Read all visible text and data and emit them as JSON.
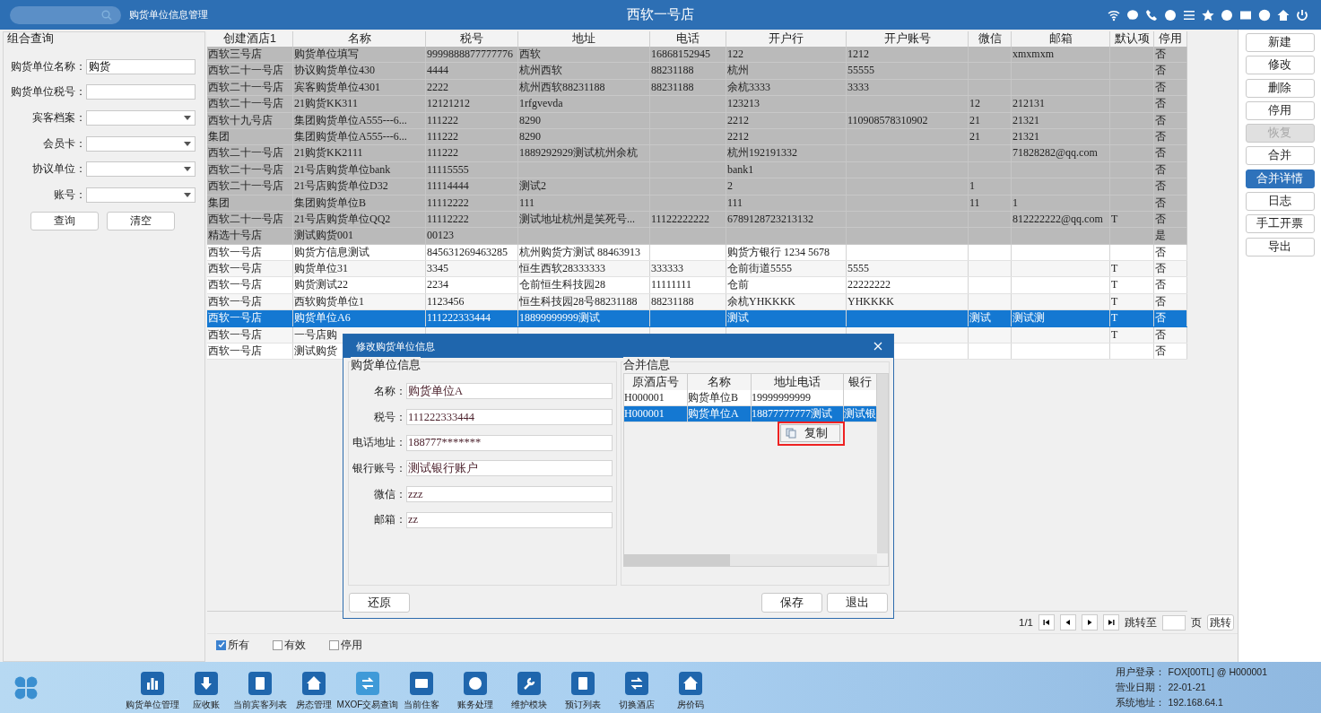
{
  "top_bar": {
    "module_title": "购货单位信息管理",
    "hotel": "西软一号店"
  },
  "filter": {
    "title": "组合查询",
    "fields": [
      {
        "label": "购货单位名称：",
        "kind": "text",
        "value": "购货"
      },
      {
        "label": "购货单位税号：",
        "kind": "text"
      },
      {
        "label": "宾客档案：",
        "kind": "select"
      },
      {
        "label": "会员卡：",
        "kind": "select"
      },
      {
        "label": "协议单位：",
        "kind": "select"
      },
      {
        "label": "账号：",
        "kind": "select"
      }
    ],
    "buttons": [
      "查询",
      "清空"
    ]
  },
  "table": {
    "columns": [
      "创建酒店1",
      "名称",
      "税号",
      "地址",
      "电话",
      "开户行",
      "开户账号",
      "微信",
      "邮箱",
      "默认项",
      "停用"
    ],
    "rows": [
      {
        "shaded": true,
        "selected": false,
        "cells": [
          "西软三号店",
          "购货单位填写",
          "9999888877777776",
          "西软",
          "16868152945",
          "122",
          "1212",
          null,
          "xmxmxm",
          null,
          "否"
        ]
      },
      {
        "shaded": true,
        "selected": false,
        "cells": [
          "西软二十一号店",
          "协议购货单位430",
          "4444",
          "杭州西软",
          "88231188",
          "杭州",
          "55555",
          null,
          null,
          null,
          "否"
        ]
      },
      {
        "shaded": true,
        "selected": false,
        "cells": [
          "西软二十一号店",
          "宾客购货单位4301",
          "2222",
          "杭州西软88231188",
          "88231188",
          "余杭3333",
          "3333",
          null,
          null,
          null,
          "否"
        ]
      },
      {
        "shaded": true,
        "selected": false,
        "cells": [
          "西软二十一号店",
          "21购货KK311",
          "12121212",
          "1rfgvevda",
          null,
          "123213",
          null,
          "12",
          "212131",
          null,
          "否"
        ]
      },
      {
        "shaded": true,
        "selected": false,
        "cells": [
          "西软十九号店",
          "集团购货单位A555---6...",
          "111222",
          "8290",
          null,
          "2212",
          "110908578310902",
          "21",
          "21321",
          null,
          "否"
        ]
      },
      {
        "shaded": true,
        "selected": false,
        "cells": [
          "集团",
          "集团购货单位A555---6...",
          "111222",
          "8290",
          null,
          "2212",
          null,
          "21",
          "21321",
          null,
          "否"
        ]
      },
      {
        "shaded": true,
        "selected": false,
        "cells": [
          "西软二十一号店",
          "21购货KK2111",
          "111222",
          "1889292929测试杭州余杭",
          null,
          "杭州192191332",
          null,
          null,
          "71828282@qq.com",
          null,
          "否"
        ]
      },
      {
        "shaded": true,
        "selected": false,
        "cells": [
          "西软二十一号店",
          "21号店购货单位bank",
          "11115555",
          null,
          null,
          "bank1",
          null,
          null,
          null,
          null,
          "否"
        ]
      },
      {
        "shaded": true,
        "selected": false,
        "cells": [
          "西软二十一号店",
          "21号店购货单位D32",
          "11114444",
          "测试2",
          null,
          "2",
          null,
          "1",
          null,
          null,
          "否"
        ]
      },
      {
        "shaded": true,
        "selected": false,
        "cells": [
          "集团",
          "集团购货单位B",
          "11112222",
          "111",
          null,
          "111",
          null,
          "11",
          "1",
          null,
          "否"
        ]
      },
      {
        "shaded": true,
        "selected": false,
        "cells": [
          "西软二十一号店",
          "21号店购货单位QQ2",
          "11112222",
          "测试地址杭州是笑死号...",
          "11122222222",
          "6789128723213132",
          null,
          null,
          "812222222@qq.com",
          "T",
          "否"
        ]
      },
      {
        "shaded": true,
        "selected": false,
        "cells": [
          "精选十号店",
          "测试购货001",
          "00123",
          null,
          null,
          null,
          null,
          null,
          null,
          null,
          "是"
        ]
      },
      {
        "shaded": false,
        "selected": false,
        "cells": [
          "西软一号店",
          "购货方信息测试",
          "845631269463285",
          "杭州购货方测试 88463913",
          null,
          "购货方银行 1234 5678",
          null,
          null,
          null,
          null,
          "否"
        ]
      },
      {
        "shaded": false,
        "selected": false,
        "cells": [
          "西软一号店",
          "购货单位31",
          "3345",
          "恒生西软28333333",
          "333333",
          "仓前街道5555",
          "5555",
          null,
          null,
          "T",
          "否"
        ]
      },
      {
        "shaded": false,
        "selected": false,
        "cells": [
          "西软一号店",
          "购货测试22",
          "2234",
          "仓前恒生科技园28",
          "11111111",
          "仓前",
          "22222222",
          null,
          null,
          "T",
          "否"
        ]
      },
      {
        "shaded": false,
        "selected": false,
        "cells": [
          "西软一号店",
          "西软购货单位1",
          "1123456",
          "恒生科技园28号88231188",
          "88231188",
          "余杭YHKKKK",
          "YHKKKK",
          null,
          null,
          "T",
          "否"
        ]
      },
      {
        "shaded": false,
        "selected": true,
        "cells": [
          "西软一号店",
          "购货单位A6",
          "111222333444",
          "18899999999测试",
          null,
          "测试",
          null,
          "测试",
          "测试测",
          "T",
          "否"
        ]
      },
      {
        "shaded": false,
        "selected": false,
        "cells": [
          "西软一号店",
          "一号店购",
          null,
          null,
          null,
          null,
          null,
          null,
          null,
          "T",
          "否"
        ]
      },
      {
        "shaded": false,
        "selected": false,
        "cells": [
          "西软一号店",
          "测试购货",
          null,
          null,
          null,
          null,
          null,
          null,
          null,
          null,
          "否"
        ]
      }
    ]
  },
  "pager": {
    "page": "1/1",
    "jump_label": "跳转至",
    "page_unit": "页",
    "jump_button": "跳转"
  },
  "filters": [
    {
      "label": "所有",
      "checked": true
    },
    {
      "label": "有效",
      "checked": false
    },
    {
      "label": "停用",
      "checked": false
    }
  ],
  "actions": [
    {
      "label": "新建",
      "disabled": false,
      "selected": false
    },
    {
      "label": "修改",
      "disabled": false,
      "selected": false
    },
    {
      "label": "删除",
      "disabled": false,
      "selected": false
    },
    {
      "label": "停用",
      "disabled": false,
      "selected": false
    },
    {
      "label": "恢复",
      "disabled": true,
      "selected": false
    },
    {
      "label": "合并",
      "disabled": false,
      "selected": false
    },
    {
      "label": "合并详情",
      "disabled": false,
      "selected": true
    },
    {
      "label": "日志",
      "disabled": false,
      "selected": false
    },
    {
      "label": "手工开票",
      "disabled": false,
      "selected": false
    },
    {
      "label": "导出",
      "disabled": false,
      "selected": false
    }
  ],
  "dialog": {
    "title": "修改购货单位信息",
    "info_title": "购货单位信息",
    "fields": [
      {
        "label": "名称：",
        "value": "购货单位A"
      },
      {
        "label": "税号：",
        "value": "111222333444"
      },
      {
        "label": "电话地址：",
        "value": "188777*******"
      },
      {
        "label": "银行账号：",
        "value": "测试银行账户"
      },
      {
        "label": "微信：",
        "value": "zzz"
      },
      {
        "label": "邮箱：",
        "value": "zz"
      }
    ],
    "merge_title": "合并信息",
    "merge_columns": [
      "原酒店号",
      "名称",
      "地址电话",
      "银行"
    ],
    "merge_rows": [
      {
        "selected": false,
        "cells": [
          "H000001",
          "购货单位B",
          "19999999999",
          null
        ]
      },
      {
        "selected": true,
        "cells": [
          "H000001",
          "购货单位A",
          "18877777777测试",
          "测试银"
        ]
      }
    ],
    "context_menu": [
      "复制"
    ],
    "buttons": [
      {
        "label": "还原"
      },
      {
        "label": "保存"
      },
      {
        "label": "退出"
      }
    ]
  },
  "taskbar": {
    "items": [
      "购货单位管理",
      "应收账",
      "当前宾客列表",
      "房态管理",
      "MXOF交易查询",
      "当前住客",
      "账务处理",
      "维护模块",
      "预订列表",
      "切换酒店",
      "房价码"
    ],
    "status": [
      {
        "label": "用户登录：",
        "value": "FOX[00TL] @ H000001"
      },
      {
        "label": "营业日期：",
        "value": "22-01-21"
      },
      {
        "label": "系统地址：",
        "value": "192.168.64.1"
      }
    ]
  }
}
